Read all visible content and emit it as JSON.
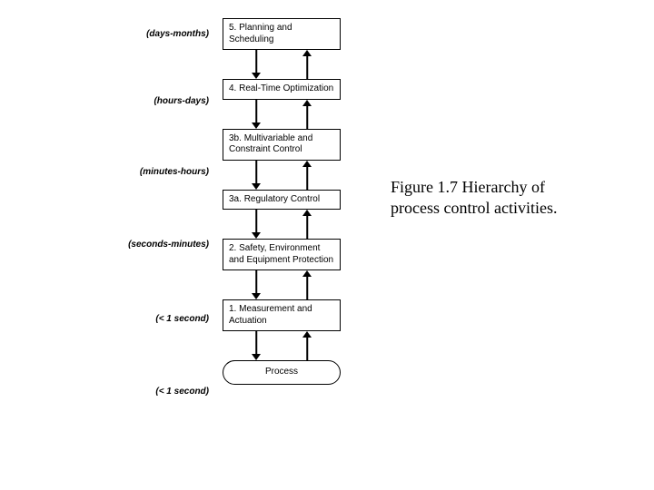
{
  "levels": [
    {
      "num": "5.",
      "title": "Planning and Scheduling",
      "timescale": "(days-months)"
    },
    {
      "num": "4.",
      "title": "Real-Time Optimization",
      "timescale": "(hours-days)"
    },
    {
      "num": "3b.",
      "title": "Multivariable and Constraint Control",
      "timescale": "(minutes-hours)"
    },
    {
      "num": "3a.",
      "title": "Regulatory Control",
      "timescale": "(seconds-minutes)"
    },
    {
      "num": "2.",
      "title": "Safety, Environment and Equipment Protection",
      "timescale": "(< 1 second)"
    },
    {
      "num": "1.",
      "title": "Measurement and Actuation",
      "timescale": "(< 1 second)"
    }
  ],
  "process_label": "Process",
  "caption": "Figure 1.7 Hierarchy of process control activities."
}
